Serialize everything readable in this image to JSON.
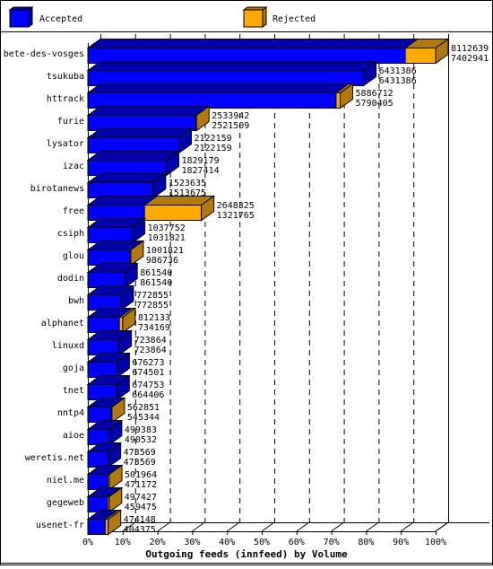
{
  "chart_data": {
    "type": "bar",
    "orientation": "horizontal",
    "stacked": true,
    "style": "3d",
    "title": "Outgoing feeds (innfeed) by Volume",
    "xlabel": "Outgoing feeds (innfeed) by Volume",
    "ylabel": "",
    "xlim": [
      0,
      100
    ],
    "x_unit": "%",
    "grid": true,
    "legend_position": "top",
    "x_ticks": [
      "0%",
      "10%",
      "20%",
      "30%",
      "40%",
      "50%",
      "60%",
      "70%",
      "80%",
      "90%",
      "100%"
    ],
    "categories": [
      "bete-des-vosges",
      "tsukuba",
      "httrack",
      "furie",
      "lysator",
      "izac",
      "birotanews",
      "free",
      "csiph",
      "glou",
      "dodin",
      "bwh",
      "alphanet",
      "linuxd",
      "goja",
      "tnet",
      "nntp4",
      "aioe",
      "weretis.net",
      "niel.me",
      "gegeweb",
      "usenet-fr"
    ],
    "offered": [
      8112639,
      6431386,
      5886712,
      2533942,
      2122159,
      1829179,
      1523635,
      2648325,
      1037752,
      1001821,
      861540,
      772855,
      812133,
      723864,
      676273,
      674753,
      562851,
      499383,
      473569,
      501964,
      497427,
      474148
    ],
    "accepted": [
      7402941,
      6431386,
      5790405,
      2521509,
      2122159,
      1827414,
      1513675,
      1321765,
      1031821,
      986736,
      861540,
      772855,
      734169,
      723864,
      674501,
      664406,
      545344,
      490532,
      473569,
      471172,
      459475,
      404375
    ],
    "series": [
      {
        "name": "Accepted",
        "color": "#0000ff",
        "side_color": "#0000aa"
      },
      {
        "name": "Rejected",
        "color": "#ffaa00",
        "side_color": "#b07a10"
      }
    ]
  },
  "legend": {
    "items": [
      {
        "label": "Accepted",
        "color": "#0000ff"
      },
      {
        "label": "Rejected",
        "color": "#ffaa00"
      }
    ]
  }
}
